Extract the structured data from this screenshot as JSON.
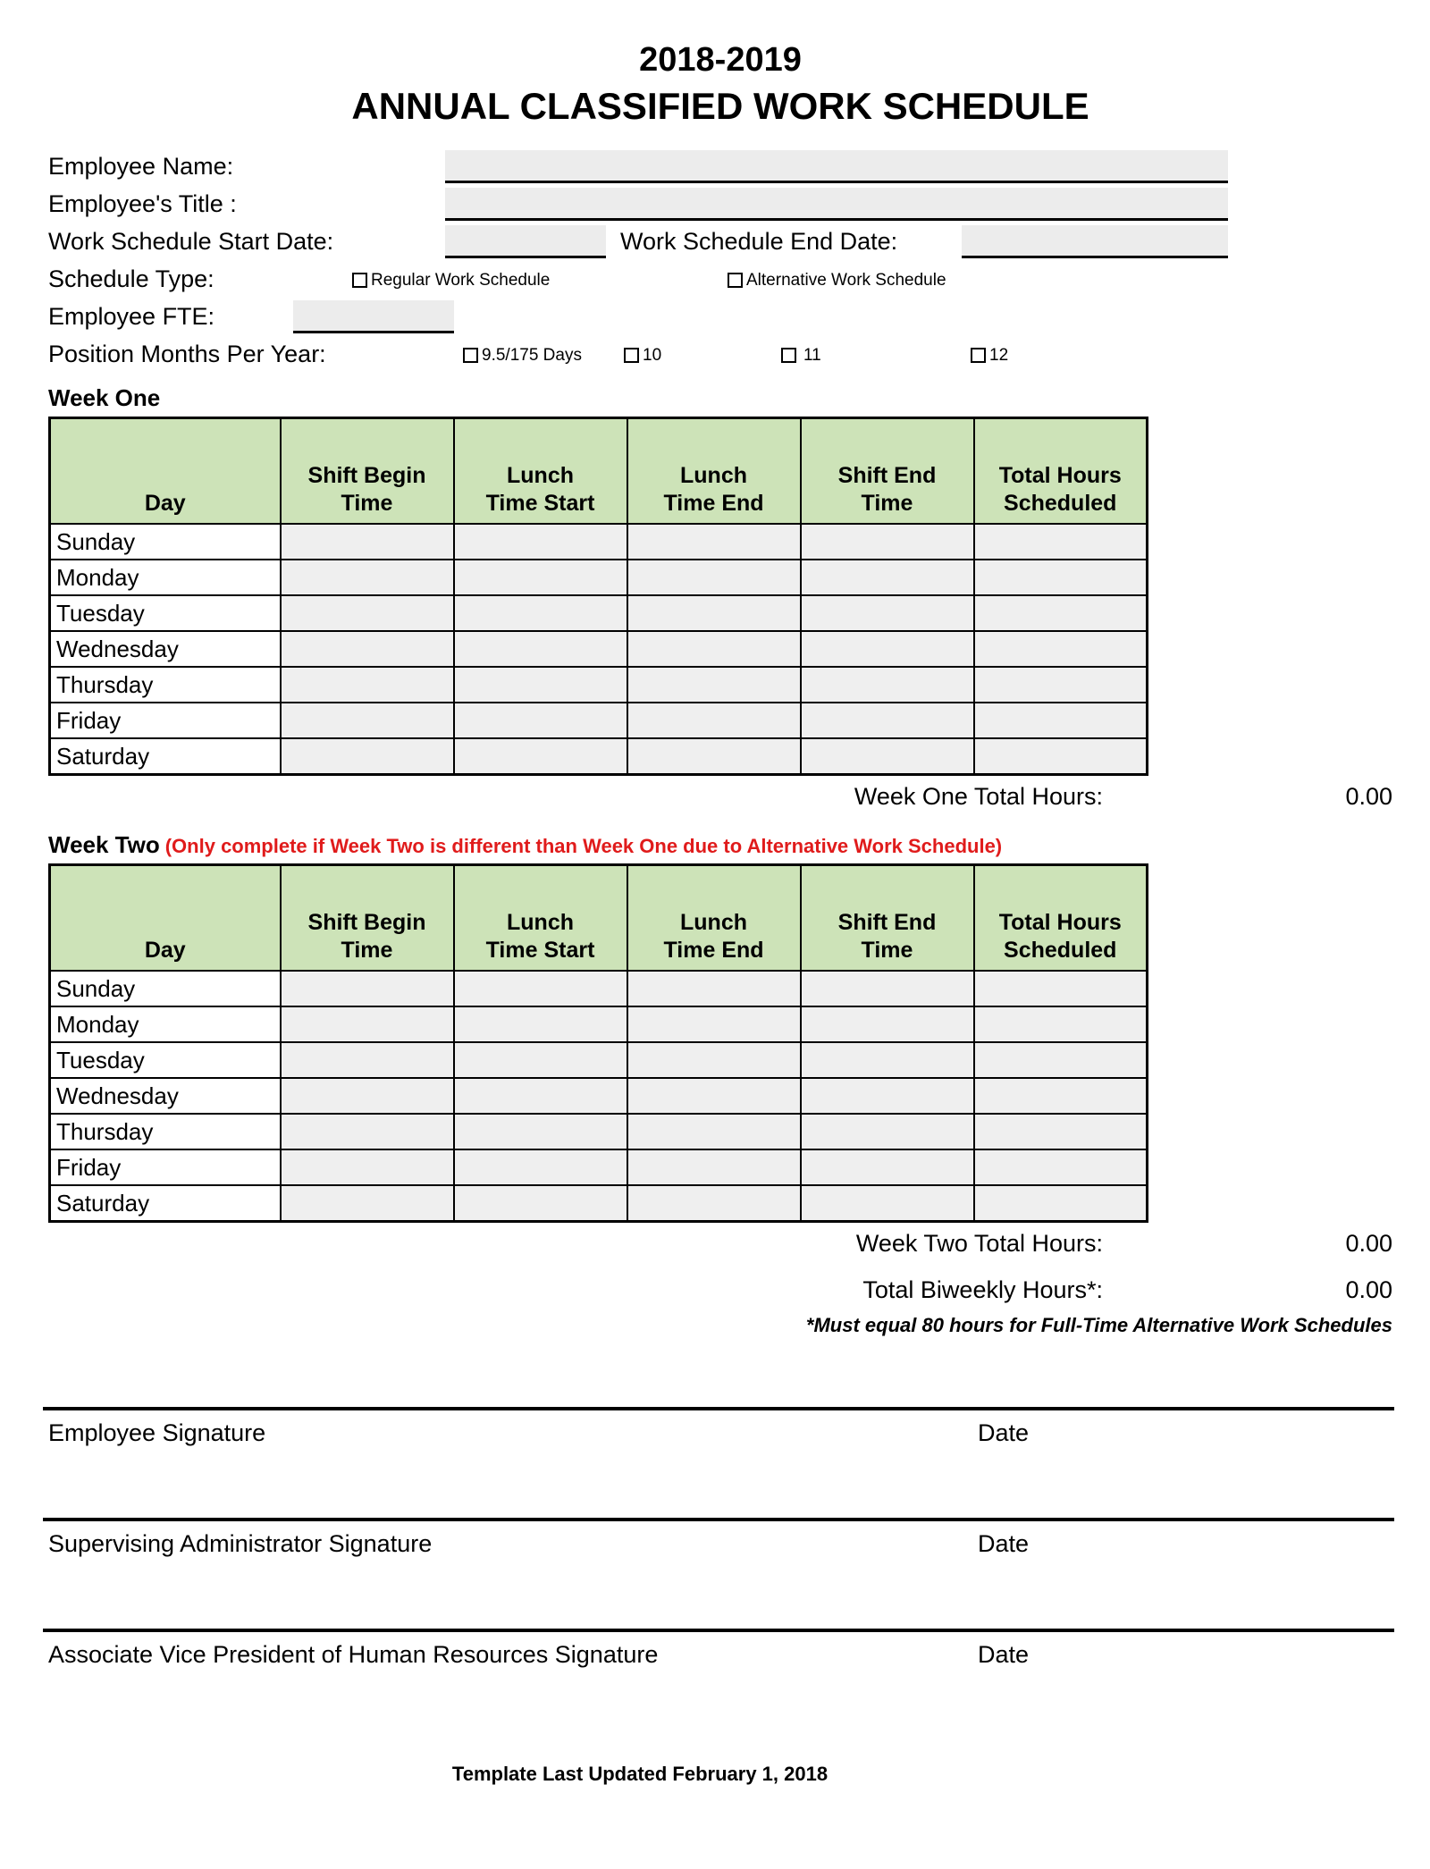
{
  "document": {
    "title_year": "2018-2019",
    "title_main": "ANNUAL CLASSIFIED WORK SCHEDULE",
    "template_note": "Template Last Updated February 1, 2018"
  },
  "header_fields": {
    "employee_name_label": "Employee Name:",
    "employee_name_value": "",
    "employee_title_label": "Employee's Title :",
    "employee_title_value": "",
    "start_date_label": "Work Schedule Start Date:",
    "start_date_value": "",
    "end_date_label": "Work Schedule End Date:",
    "end_date_value": "",
    "schedule_type_label": "Schedule Type:",
    "schedule_type_options": [
      {
        "label": "Regular Work Schedule",
        "checked": false
      },
      {
        "label": "Alternative Work Schedule",
        "checked": false
      }
    ],
    "fte_label": "Employee FTE:",
    "fte_value": "",
    "position_months_label": "Position Months Per Year:",
    "position_months_options": [
      {
        "label": "9.5/175 Days",
        "checked": false
      },
      {
        "label": "10",
        "checked": false
      },
      {
        "label": "11",
        "checked": false
      },
      {
        "label": "12",
        "checked": false
      }
    ]
  },
  "table_columns": [
    "Day",
    "Shift Begin Time",
    "Lunch Time Start",
    "Lunch Time End",
    "Shift End Time",
    "Total Hours Scheduled"
  ],
  "table_columns_wrapped": [
    {
      "line1": "",
      "line2": "Day"
    },
    {
      "line1": "Shift Begin",
      "line2": "Time"
    },
    {
      "line1": "Lunch",
      "line2": "Time Start"
    },
    {
      "line1": "Lunch",
      "line2": "Time End"
    },
    {
      "line1": "Shift End",
      "line2": "Time"
    },
    {
      "line1": "Total Hours",
      "line2": "Scheduled"
    }
  ],
  "week_one": {
    "heading": "Week One",
    "note": "",
    "rows": [
      {
        "day": "Sunday",
        "shift_begin": "",
        "lunch_start": "",
        "lunch_end": "",
        "shift_end": "",
        "total": ""
      },
      {
        "day": "Monday",
        "shift_begin": "",
        "lunch_start": "",
        "lunch_end": "",
        "shift_end": "",
        "total": ""
      },
      {
        "day": "Tuesday",
        "shift_begin": "",
        "lunch_start": "",
        "lunch_end": "",
        "shift_end": "",
        "total": ""
      },
      {
        "day": "Wednesday",
        "shift_begin": "",
        "lunch_start": "",
        "lunch_end": "",
        "shift_end": "",
        "total": ""
      },
      {
        "day": "Thursday",
        "shift_begin": "",
        "lunch_start": "",
        "lunch_end": "",
        "shift_end": "",
        "total": ""
      },
      {
        "day": "Friday",
        "shift_begin": "",
        "lunch_start": "",
        "lunch_end": "",
        "shift_end": "",
        "total": ""
      },
      {
        "day": "Saturday",
        "shift_begin": "",
        "lunch_start": "",
        "lunch_end": "",
        "shift_end": "",
        "total": ""
      }
    ],
    "total_label": "Week One Total Hours:",
    "total_value": "0.00"
  },
  "week_two": {
    "heading": "Week Two",
    "note": "(Only complete if Week Two is different than Week One due to Alternative Work Schedule)",
    "rows": [
      {
        "day": "Sunday",
        "shift_begin": "",
        "lunch_start": "",
        "lunch_end": "",
        "shift_end": "",
        "total": ""
      },
      {
        "day": "Monday",
        "shift_begin": "",
        "lunch_start": "",
        "lunch_end": "",
        "shift_end": "",
        "total": ""
      },
      {
        "day": "Tuesday",
        "shift_begin": "",
        "lunch_start": "",
        "lunch_end": "",
        "shift_end": "",
        "total": ""
      },
      {
        "day": "Wednesday",
        "shift_begin": "",
        "lunch_start": "",
        "lunch_end": "",
        "shift_end": "",
        "total": ""
      },
      {
        "day": "Thursday",
        "shift_begin": "",
        "lunch_start": "",
        "lunch_end": "",
        "shift_end": "",
        "total": ""
      },
      {
        "day": "Friday",
        "shift_begin": "",
        "lunch_start": "",
        "lunch_end": "",
        "shift_end": "",
        "total": ""
      },
      {
        "day": "Saturday",
        "shift_begin": "",
        "lunch_start": "",
        "lunch_end": "",
        "shift_end": "",
        "total": ""
      }
    ],
    "total_label": "Week Two Total Hours:",
    "total_value": "0.00"
  },
  "biweekly": {
    "label": "Total Biweekly Hours*:",
    "value": "0.00",
    "footnote": "*Must equal 80 hours for Full-Time Alternative Work Schedules"
  },
  "signatures": [
    {
      "label": "Employee Signature",
      "date_label": "Date"
    },
    {
      "label": "Supervising Administrator Signature",
      "date_label": "Date"
    },
    {
      "label": "Associate Vice President of Human Resources Signature",
      "date_label": "Date"
    }
  ],
  "colors": {
    "header_green": "#cde3b8",
    "field_fill": "#ececec",
    "cell_fill": "#efefef",
    "note_red": "#e01b1b"
  }
}
